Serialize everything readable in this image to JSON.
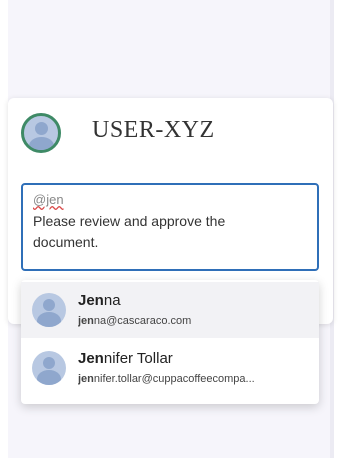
{
  "comment": {
    "author": "USER-XYZ",
    "mention_text": "@jen",
    "message": "Please review and approve the document."
  },
  "suggestions": [
    {
      "name_match": "Jen",
      "name_rest": "na",
      "email_match": "jen",
      "email_rest": "na@cascaraco.com"
    },
    {
      "name_match": "Jen",
      "name_rest": "nifer Tollar",
      "email_match": "jen",
      "email_rest": "nifer.tollar@cuppacoffeecompa..."
    }
  ],
  "colors": {
    "accent": "#2f6fb8",
    "avatar_ring": "#3e8a66",
    "highlight_row": "#f2f2f5"
  },
  "icons": {
    "avatar": "user-avatar-icon"
  }
}
